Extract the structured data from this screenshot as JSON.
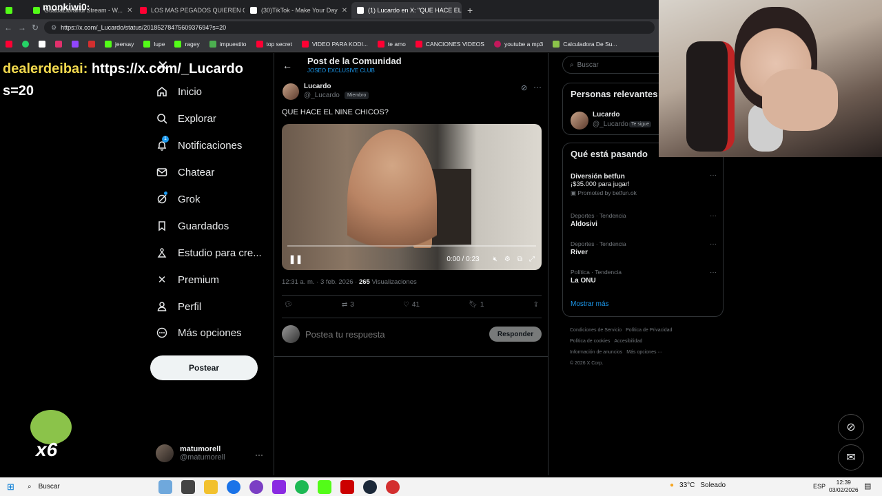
{
  "browser": {
    "tabs": [
      {
        "label": "GuadaLibrandi Stream - W...",
        "icon_color": "#53fc18"
      },
      {
        "label": "LOS MAS PEGADOS QUIEREN CO",
        "icon_color": "#ff0033"
      },
      {
        "label": "(30)TikTok - Make Your Day",
        "icon_color": "#ffffff"
      },
      {
        "label": "(1) Lucardo en X: \"QUE HACE EL N",
        "icon_color": "#ffffff",
        "active": true
      }
    ],
    "url": "https://x.com/_Lucardo/status/2018527847560937694?s=20",
    "bookmarks": [
      {
        "label": "jeersay",
        "icon_color": "#53fc18"
      },
      {
        "label": "lupe",
        "icon_color": "#53fc18"
      },
      {
        "label": "ragey",
        "icon_color": "#53fc18"
      },
      {
        "label": "impuestito",
        "icon_color": "#4caf50"
      },
      {
        "label": "top secret",
        "icon_color": "#ff0033"
      },
      {
        "label": "VIDEO PARA KODI...",
        "icon_color": "#ff0033"
      },
      {
        "label": "te amo",
        "icon_color": "#ff0033"
      },
      {
        "label": "CANCIONES VIDEOS",
        "icon_color": "#ff0033"
      },
      {
        "label": "youtube a mp3",
        "icon_color": "#c2185b"
      },
      {
        "label": "Calculadora De Su...",
        "icon_color": "#8bc34a"
      }
    ]
  },
  "overlay": {
    "chat_user": "dealerdeibai:",
    "chat_line1": "https://x.com/_Lucardo",
    "chat_line2": "s=20",
    "streamer_name": "monkiwi0:",
    "emote_count": "x6"
  },
  "nav": {
    "items": [
      {
        "label": "Inicio",
        "icon": "home-icon"
      },
      {
        "label": "Explorar",
        "icon": "search-icon"
      },
      {
        "label": "Notificaciones",
        "icon": "bell-icon"
      },
      {
        "label": "Chatear",
        "icon": "mail-icon"
      },
      {
        "label": "Grok",
        "icon": "grok-icon"
      },
      {
        "label": "Guardados",
        "icon": "bookmark-icon"
      },
      {
        "label": "Estudio para cre...",
        "icon": "creator-icon"
      },
      {
        "label": "Premium",
        "icon": "x-icon"
      },
      {
        "label": "Perfil",
        "icon": "profile-icon"
      },
      {
        "label": "Más opciones",
        "icon": "more-icon"
      }
    ],
    "notification_badge": "1",
    "post_button": "Postear",
    "account_name": "matumorell",
    "account_handle": "@matumorell"
  },
  "post": {
    "header_title": "Post de la Comunidad",
    "header_sub": "JOSEO EXCLUSIVE CLUB",
    "author_name": "Lucardo",
    "author_handle": "@_Lucardo",
    "member_badge": "Miembro",
    "text": "QUE HACE EL NINE CHICOS?",
    "video_time": "0:00 / 0:23",
    "video_progress": 0.0,
    "timestamp": "12:31 a. m. · 3 feb. 2026 · ",
    "views": "265",
    "views_label": "Visualizaciones",
    "reposts": "3",
    "likes": "41",
    "bookmarks": "1",
    "reply_placeholder": "Postea tu respuesta",
    "reply_button": "Responder"
  },
  "sidebar": {
    "search_placeholder": "Buscar",
    "relevant_title": "Personas relevantes",
    "relevant_name": "Lucardo",
    "relevant_handle": "@_Lucardo",
    "relevant_badge": "Te sigue",
    "trends_title": "Qué está pasando",
    "trends": [
      {
        "category": "",
        "name": "Diversión betfun",
        "sub": "¡$35.000 para jugar!",
        "promo": "Promoted by betfun.ok"
      },
      {
        "category": "Deportes · Tendencia",
        "name": "Aldosivi"
      },
      {
        "category": "Deportes · Tendencia",
        "name": "River"
      },
      {
        "category": "Política · Tendencia",
        "name": "La ONU"
      }
    ],
    "show_more": "Mostrar más",
    "footer": [
      "Condiciones de Servicio",
      "Política de Privacidad",
      "Política de cookies",
      "Accesibilidad",
      "Información de anuncios",
      "Más opciones ···",
      "© 2026 X Corp."
    ]
  },
  "taskbar": {
    "search": "Buscar",
    "weather": "33°C",
    "weather_desc": "Soleado",
    "lang": "ESP",
    "time": "12:39",
    "date": "03/02/2026"
  }
}
